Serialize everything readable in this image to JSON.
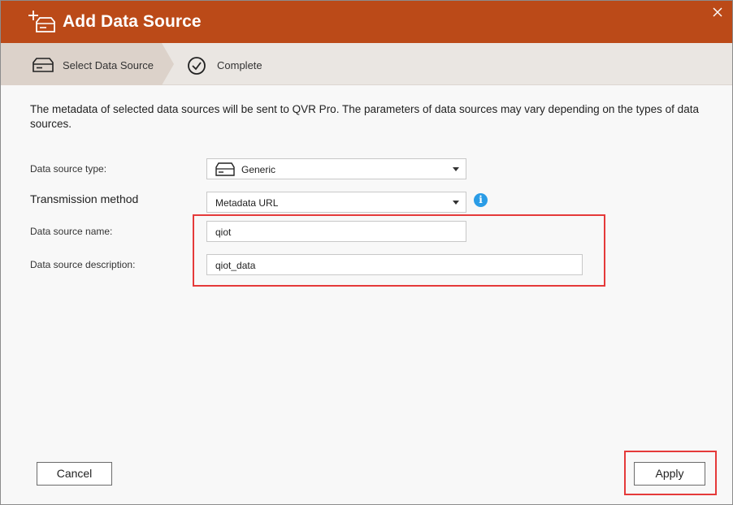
{
  "dialog": {
    "title": "Add Data Source",
    "title_icon": "add-storage-icon",
    "close_icon": "close-icon"
  },
  "steps": [
    {
      "label": "Select Data Source",
      "icon": "storage-icon",
      "active": true
    },
    {
      "label": "Complete",
      "icon": "check-circle-icon",
      "active": false
    }
  ],
  "description": "The metadata of selected data sources will be sent to QVR Pro. The parameters of data sources may vary depending on the types of data sources.",
  "form": {
    "type_label": "Data source type:",
    "type_value": "Generic",
    "method_label": "Transmission method",
    "method_value": "Metadata URL",
    "name_label": "Data source name:",
    "name_value": "qiot",
    "desc_label": "Data source description:",
    "desc_value": "qiot_data"
  },
  "buttons": {
    "cancel": "Cancel",
    "apply": "Apply"
  },
  "colors": {
    "titlebar": "#bb4a18",
    "highlight": "#e53a3a",
    "info": "#2a9ce6"
  }
}
